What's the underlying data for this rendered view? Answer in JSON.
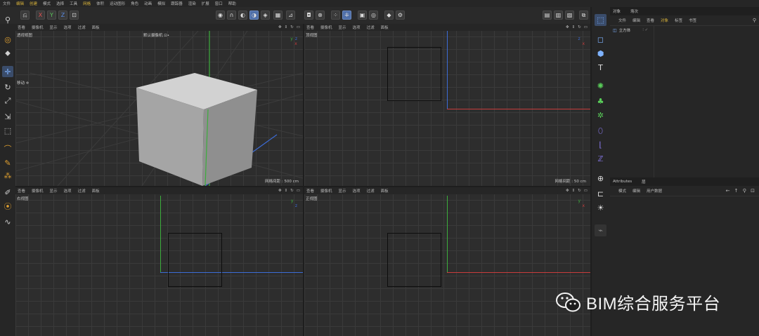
{
  "menubar": {
    "items": [
      "文件",
      "编辑",
      "创建",
      "模式",
      "选择",
      "工具",
      "网格",
      "体积",
      "运动图形",
      "角色",
      "动画",
      "模拟",
      "跟踪器",
      "渲染",
      "扩展",
      "窗口",
      "帮助"
    ],
    "highlight_indices": [
      1,
      2,
      6
    ]
  },
  "toolbar": {
    "axis_x": "X",
    "axis_y": "Y",
    "axis_z": "Z"
  },
  "viewports": {
    "perspective": {
      "menu": [
        "查看",
        "摄像机",
        "显示",
        "选项",
        "过滤",
        "面板"
      ],
      "label": "透视视图",
      "camera": "默认摄像机 ⊡•",
      "side_label": "移动 ✛",
      "grid": "网格间距 : 500 cm"
    },
    "top": {
      "menu": [
        "查看",
        "摄像机",
        "显示",
        "选项",
        "过滤",
        "面板"
      ],
      "label": "顶视图",
      "grid": "网格间距 : 50 cm"
    },
    "right": {
      "menu": [
        "查看",
        "摄像机",
        "显示",
        "选项",
        "过滤",
        "面板"
      ],
      "label": "右视图"
    },
    "front": {
      "menu": [
        "查看",
        "摄像机",
        "显示",
        "选项",
        "过滤",
        "面板"
      ],
      "label": "正视图"
    }
  },
  "objects_panel": {
    "tabs": [
      "对象",
      "场次"
    ],
    "menu": [
      "文件",
      "编辑",
      "查看",
      "对象",
      "标签",
      "书签"
    ],
    "item": "立方体"
  },
  "attributes_panel": {
    "tabs": [
      "Attributes",
      "层"
    ],
    "menu": [
      "模式",
      "编辑",
      "用户数据"
    ]
  },
  "watermark": {
    "text": "BIM综合服务平台"
  },
  "colors": {
    "axis_x": "#c83c3c",
    "axis_y": "#3cae3c",
    "axis_z": "#3c6cd6",
    "accent": "#d8b23a",
    "active_tool": "#4f6fa8"
  }
}
